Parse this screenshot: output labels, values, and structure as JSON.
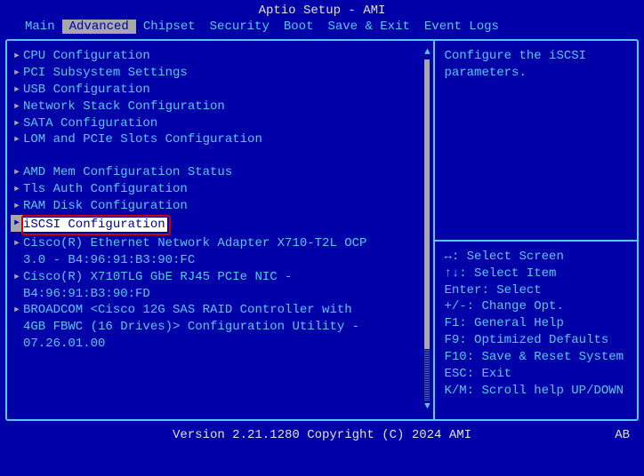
{
  "title": "Aptio Setup - AMI",
  "menu": [
    "Main",
    "Advanced",
    "Chipset",
    "Security",
    "Boot",
    "Save & Exit",
    "Event Logs"
  ],
  "active_menu_index": 1,
  "items": [
    {
      "type": "item",
      "label": "CPU Configuration"
    },
    {
      "type": "item",
      "label": "PCI Subsystem Settings"
    },
    {
      "type": "item",
      "label": "USB Configuration"
    },
    {
      "type": "item",
      "label": "Network Stack Configuration"
    },
    {
      "type": "item",
      "label": "SATA Configuration"
    },
    {
      "type": "item",
      "label": "LOM and PCIe Slots Configuration"
    },
    {
      "type": "blank"
    },
    {
      "type": "item",
      "label": "AMD Mem Configuration Status"
    },
    {
      "type": "item",
      "label": "Tls Auth Configuration"
    },
    {
      "type": "item",
      "label": "RAM Disk Configuration"
    },
    {
      "type": "item",
      "label": "iSCSI Configuration",
      "selected": true,
      "boxed": true
    },
    {
      "type": "item",
      "label": "Cisco(R) Ethernet Network Adapter X710-T2L OCP"
    },
    {
      "type": "sub",
      "label": "3.0 - B4:96:91:B3:90:FC"
    },
    {
      "type": "item",
      "label": "Cisco(R) X710TLG GbE RJ45 PCIe NIC -"
    },
    {
      "type": "sub",
      "label": "B4:96:91:B3:90:FD"
    },
    {
      "type": "item",
      "label": "BROADCOM <Cisco 12G SAS RAID Controller with"
    },
    {
      "type": "sub",
      "label": "4GB FBWC (16 Drives)> Configuration Utility -"
    },
    {
      "type": "sub",
      "label": "07.26.01.00"
    }
  ],
  "help_text": "Configure the iSCSI parameters.",
  "keys": [
    "↔: Select Screen",
    "↑↓: Select Item",
    "Enter: Select",
    "+/-: Change Opt.",
    "F1: General Help",
    "F9: Optimized Defaults",
    "F10: Save & Reset System",
    "ESC: Exit",
    "K/M: Scroll help UP/DOWN"
  ],
  "footer": "Version 2.21.1280 Copyright (C) 2024 AMI",
  "footer_right": "AB"
}
